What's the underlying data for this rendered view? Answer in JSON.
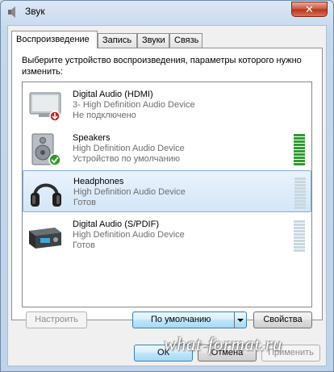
{
  "window": {
    "title": "Звук",
    "close_label": "✕"
  },
  "tabs": [
    {
      "label": "Воспроизведение"
    },
    {
      "label": "Запись"
    },
    {
      "label": "Звуки"
    },
    {
      "label": "Связь"
    }
  ],
  "instruction": "Выберите устройство воспроизведения, параметры которого нужно изменить:",
  "devices": [
    {
      "name": "Digital Audio (HDMI)",
      "driver": "3- High Definition Audio Device",
      "status": "Не подключено",
      "meter_level": 0
    },
    {
      "name": "Speakers",
      "driver": "High Definition Audio Device",
      "status": "Устройство по умолчанию",
      "meter_level": 1
    },
    {
      "name": "Headphones",
      "driver": "High Definition Audio Device",
      "status": "Готов",
      "meter_level": 0
    },
    {
      "name": "Digital Audio (S/PDIF)",
      "driver": "High Definition Audio Device",
      "status": "Готов",
      "meter_level": 0
    }
  ],
  "buttons": {
    "configure": "Настроить",
    "set_default": "По умолчанию",
    "properties": "Свойства",
    "ok": "ОК",
    "cancel": "Отмена",
    "apply": "Применить"
  },
  "watermark": "what-format.ru",
  "colors": {
    "selection": "#d3e6f8",
    "meter_active": "#2f9b2f",
    "meter_idle": "#c9d7df"
  }
}
